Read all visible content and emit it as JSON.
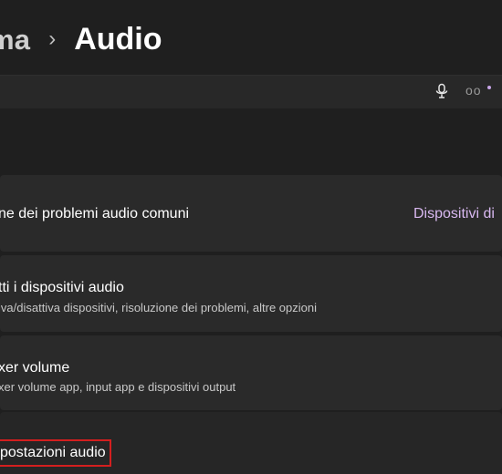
{
  "header": {
    "breadcrumb_parent": "ma",
    "separator": "›",
    "title": "Audio"
  },
  "top_strip": {
    "icons": [
      "microphone-icon",
      "more-icon"
    ],
    "accent_color": "#c8a6e8"
  },
  "cards": {
    "troubleshoot": {
      "title": "ne dei problemi audio comuni",
      "link": "Dispositivi di"
    },
    "all_devices": {
      "title": "tti i dispositivi audio",
      "subtitle": "iva/disattiva dispositivi, risoluzione dei problemi, altre opzioni"
    },
    "mixer": {
      "title": "xer volume",
      "subtitle": "xer volume app, input app e dispositivi output"
    },
    "settings": {
      "title": "postazioni audio"
    }
  },
  "colors": {
    "background": "#1f1f1f",
    "card": "#2a2a2a",
    "link": "#d8b8f0",
    "highlight": "#d41f1f"
  }
}
